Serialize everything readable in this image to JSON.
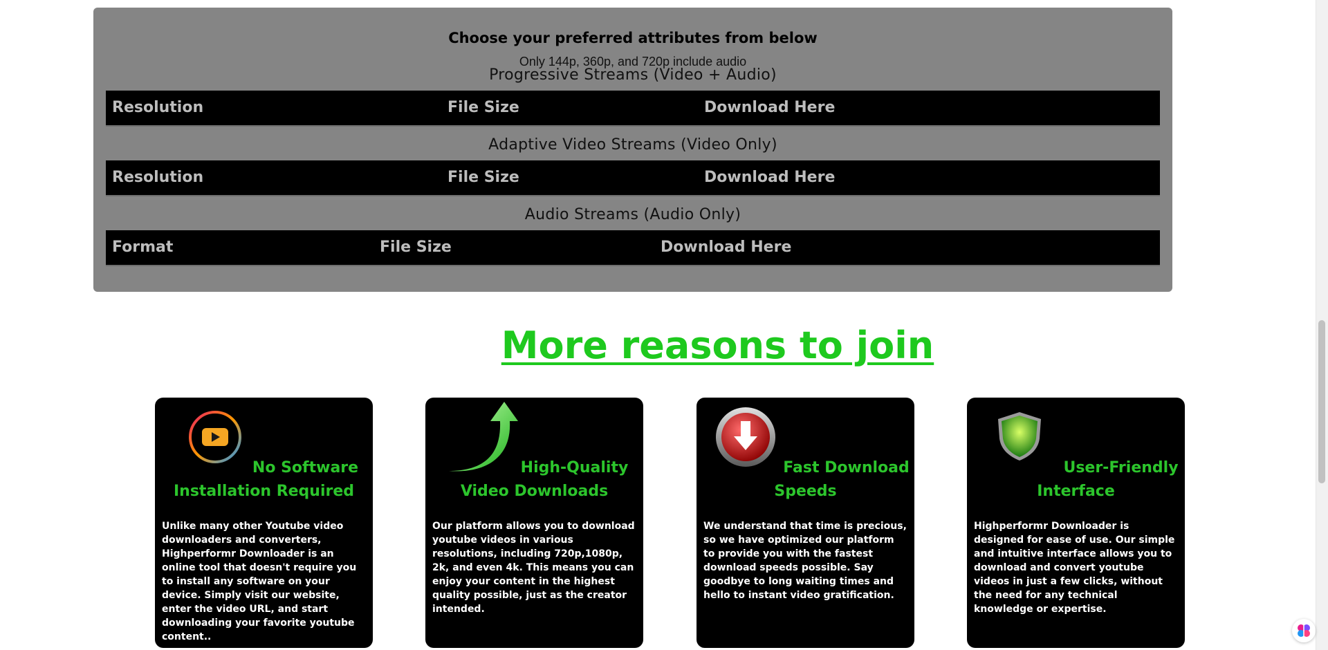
{
  "panel": {
    "title": "Choose your preferred attributes from below",
    "note": "Only 144p, 360p, and 720p include audio",
    "progressive": {
      "title": "Progressive Streams (Video + Audio)",
      "headers": [
        "Resolution",
        "File Size",
        "Download Here"
      ]
    },
    "adaptive": {
      "title": "Adaptive Video Streams (Video Only)",
      "headers": [
        "Resolution",
        "File Size",
        "Download Here"
      ]
    },
    "audio": {
      "title": "Audio Streams (Audio Only)",
      "headers": [
        "Format",
        "File Size",
        "Download Here"
      ]
    }
  },
  "reasons": {
    "heading": "More reasons to join",
    "cards": [
      {
        "icon": "youtube-play-icon",
        "title_line1": "No Software",
        "title_line2": "Installation Required",
        "text": "Unlike many other Youtube video downloaders and converters, Highperformr Downloader is an online tool that doesn't require you to install any software on your device. Simply visit our website, enter the video URL, and start downloading your favorite youtube content.."
      },
      {
        "icon": "green-curved-arrow-icon",
        "title_line1": "High-Quality",
        "title_line2": "Video Downloads",
        "text": "Our platform allows you to download youtube videos in various resolutions, including 720p,1080p, 2k, and even 4k. This means you can enjoy your content in the highest quality possible, just as the creator intended."
      },
      {
        "icon": "red-download-arrow-icon",
        "title_line1": "Fast Download",
        "title_line2": "Speeds",
        "text": "We understand that time is precious, so we have optimized our platform to provide you with the fastest download speeds possible. Say goodbye to long waiting times and hello to instant video gratification."
      },
      {
        "icon": "green-shield-icon",
        "title_line1": "User-Friendly",
        "title_line2": "Interface",
        "text": "Highperformr Downloader is designed for ease of use. Our simple and intuitive interface allows you to download and convert youtube videos in just a few clicks, without the need for any technical knowledge or expertise."
      }
    ]
  },
  "colors": {
    "accent_green": "#1ec91e",
    "panel_gray": "#858585",
    "card_black": "#000000"
  }
}
